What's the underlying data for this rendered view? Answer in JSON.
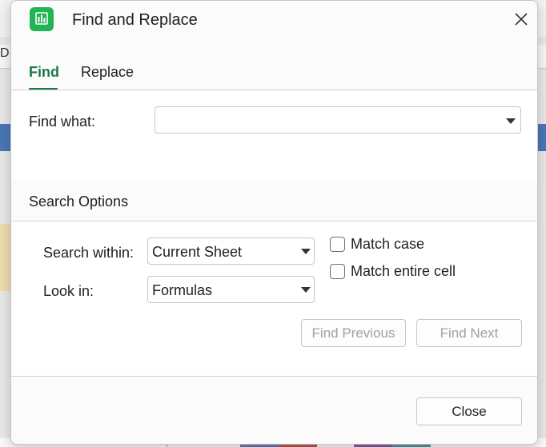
{
  "background": {
    "column_letter": "D"
  },
  "dialog": {
    "title": "Find and Replace",
    "app_icon": "spreadsheet-chart-icon",
    "close_icon": "close-icon",
    "accent_color": "#1a7a46"
  },
  "tabs": [
    {
      "label": "Find",
      "active": true
    },
    {
      "label": "Replace",
      "active": false
    }
  ],
  "find": {
    "label": "Find what:",
    "value": "",
    "placeholder": ""
  },
  "options": {
    "title": "Search Options",
    "search_within": {
      "label": "Search within:",
      "selected": "Current Sheet"
    },
    "look_in": {
      "label": "Look in:",
      "selected": "Formulas"
    },
    "match_case": {
      "label": "Match case",
      "checked": false
    },
    "match_entire_cell": {
      "label": "Match entire cell",
      "checked": false
    }
  },
  "buttons": {
    "find_previous": "Find Previous",
    "find_next": "Find Next",
    "close": "Close"
  }
}
